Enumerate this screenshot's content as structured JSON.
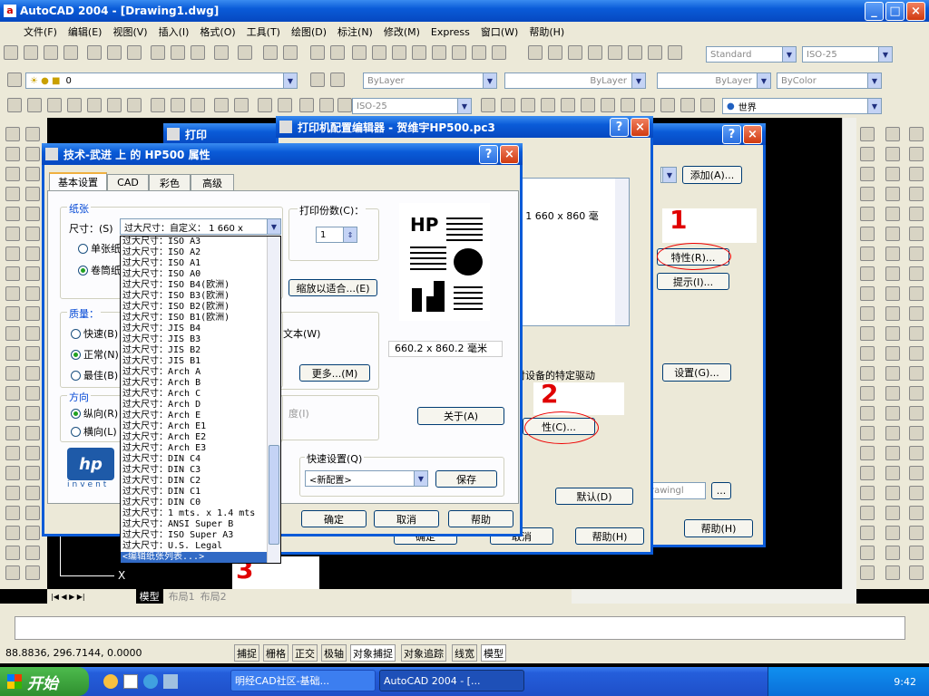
{
  "app": {
    "title": "AutoCAD 2004 - [Drawing1.dwg]"
  },
  "menu": [
    "文件(F)",
    "编辑(E)",
    "视图(V)",
    "插入(I)",
    "格式(O)",
    "工具(T)",
    "绘图(D)",
    "标注(N)",
    "修改(M)",
    "Express",
    "窗口(W)",
    "帮助(H)"
  ],
  "toolbar": {
    "style": "Standard",
    "dimstyle": "ISO-25",
    "layer": "0",
    "color": "ByLayer",
    "linetype": "ByLayer",
    "lineweight": "ByLayer",
    "plotstyle": "ByColor",
    "dimstyle2": "ISO-25",
    "ucs": "世界"
  },
  "plotDialog": {
    "title": "打印",
    "add_button": "添加(A)...",
    "props_button": "特性(R)...",
    "hints_button": "提示(I)...",
    "settings_button": "设置(G)...",
    "default_button": "默认(D)",
    "help_button": "帮助(H)",
    "ok_button": "确定",
    "cancel_button": "取消",
    "dwg_field": "rawingl"
  },
  "pc3Dialog": {
    "title": "打印机配置编辑器 - 贺维宇HP500.pc3",
    "size_text": ": 1 660 x 860 毫",
    "driver_text": "对设备的特定驱动",
    "custom_button": "性(C)...",
    "ok_button": "确定",
    "cancel_button": "取消",
    "help_button": "帮助(H)"
  },
  "propsDialog": {
    "title": "技术-武进 上 的 HP500 属性",
    "tabs": [
      "基本设置",
      "CAD",
      "彩色",
      "高级"
    ],
    "paper_group": "纸张",
    "size_label": "尺寸：(S)",
    "size_value": "过大尺寸：自定义： 1 660 x",
    "radio_single": "单张纸",
    "radio_roll": "卷筒纸",
    "quality_group": "质量：",
    "q_fast": "快速(B)",
    "q_normal": "正常(N)",
    "q_best": "最佳(B)",
    "orient_group": "方向",
    "o_portrait": "纵向(R)",
    "o_landscape": "横向(L)",
    "copies_label": "打印份数(C)：",
    "copies_value": "1",
    "fit_button": "缩放以适合...(E)",
    "text_opt": "文本(W)",
    "more_button": "更多...(M)",
    "degree": "度(I)",
    "preview_size": "660.2 x 860.2 毫米",
    "about_button": "关于(A)",
    "quick_label": "快速设置(Q)",
    "quick_value": "<新配置>",
    "save_button": "保存",
    "ok_button": "确定",
    "cancel_button": "取消",
    "help_button": "帮助",
    "hp_logo": "invent",
    "hp_brand": "HP"
  },
  "paperList": [
    "过大尺寸：ISO A3",
    "过大尺寸：ISO A2",
    "过大尺寸：ISO A1",
    "过大尺寸：ISO A0",
    "过大尺寸：ISO B4(欧洲)",
    "过大尺寸：ISO B3(欧洲)",
    "过大尺寸：ISO B2(欧洲)",
    "过大尺寸：ISO B1(欧洲)",
    "过大尺寸：JIS B4",
    "过大尺寸：JIS B3",
    "过大尺寸：JIS B2",
    "过大尺寸：JIS B1",
    "过大尺寸：Arch A",
    "过大尺寸：Arch B",
    "过大尺寸：Arch C",
    "过大尺寸：Arch D",
    "过大尺寸：Arch E",
    "过大尺寸：Arch E1",
    "过大尺寸：Arch E2",
    "过大尺寸：Arch E3",
    "过大尺寸：DIN C4",
    "过大尺寸：DIN C3",
    "过大尺寸：DIN C2",
    "过大尺寸：DIN C1",
    "过大尺寸：DIN C0",
    "过大尺寸：1 mts. x 1.4 mts",
    "过大尺寸：ANSI Super B",
    "过大尺寸：ISO Super A3",
    "过大尺寸：U.S. Legal"
  ],
  "paperListSelected": "<编辑纸张列表...>",
  "annotations": [
    "1",
    "2",
    "3"
  ],
  "layoutTabs": [
    "模型",
    "布局1",
    "布局2"
  ],
  "coords": "88.8836, 296.7144, 0.0000",
  "statusButtons": [
    "捕捉",
    "栅格",
    "正交",
    "极轴",
    "对象捕捉",
    "对象追踪",
    "线宽",
    "模型"
  ],
  "taskbar": {
    "start": "开始",
    "task1": "明经CAD社区-基础...",
    "task2": "AutoCAD 2004 - [...",
    "clock": "9:42"
  }
}
